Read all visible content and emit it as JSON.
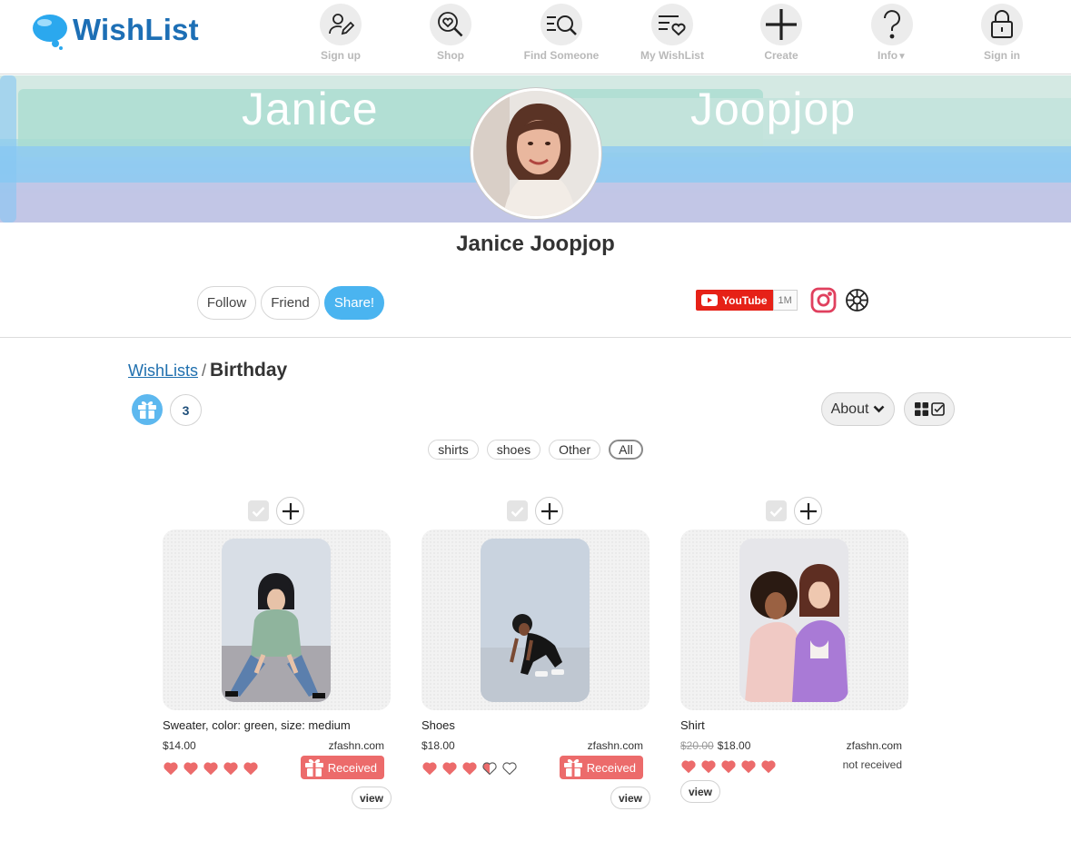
{
  "app": {
    "logo_text": "WishList"
  },
  "nav": [
    {
      "label": "Sign up",
      "icon": "sign-up-icon"
    },
    {
      "label": "Shop",
      "icon": "shop-heart-search-icon"
    },
    {
      "label": "Find Someone",
      "icon": "find-someone-icon"
    },
    {
      "label": "My WishList",
      "icon": "my-wishlist-icon"
    },
    {
      "label": "Create",
      "icon": "plus-icon"
    },
    {
      "label": "Info",
      "icon": "question-icon"
    },
    {
      "label": "Sign in",
      "icon": "lock-icon"
    }
  ],
  "banner": {
    "first_name": "Janice",
    "last_name": "Joopjop"
  },
  "profile": {
    "name": "Janice Joopjop"
  },
  "actions": {
    "follow": "Follow",
    "friend": "Friend",
    "share": "Share!"
  },
  "social": {
    "youtube_label": "YouTube",
    "youtube_count": "1M",
    "instagram": "instagram-icon",
    "other": "wheel-icon"
  },
  "breadcrumb": {
    "root": "WishLists",
    "separator": "/",
    "current": "Birthday"
  },
  "toolbar": {
    "gift_count": "3",
    "about_label": "About"
  },
  "tags": [
    {
      "label": "shirts",
      "active": false
    },
    {
      "label": "shoes",
      "active": false
    },
    {
      "label": "Other",
      "active": false
    },
    {
      "label": "All",
      "active": true
    }
  ],
  "items": [
    {
      "title": "Sweater, color: green, size: medium",
      "price": "$14.00",
      "old_price": "",
      "store": "zfashn.com",
      "rating": 5,
      "status": "Received",
      "view": "view"
    },
    {
      "title": "Shoes",
      "price": "$18.00",
      "old_price": "",
      "store": "zfashn.com",
      "rating": 3.5,
      "status": "Received",
      "view": "view"
    },
    {
      "title": "Shirt",
      "price": "$18.00",
      "old_price": "$20.00",
      "store": "zfashn.com",
      "rating": 5,
      "status": "not received",
      "view": "view"
    }
  ],
  "colors": {
    "brand_blue": "#1d6fb5",
    "share_blue": "#4ab4f0",
    "heart_red": "#ec6b6b",
    "youtube_red": "#e62117"
  }
}
